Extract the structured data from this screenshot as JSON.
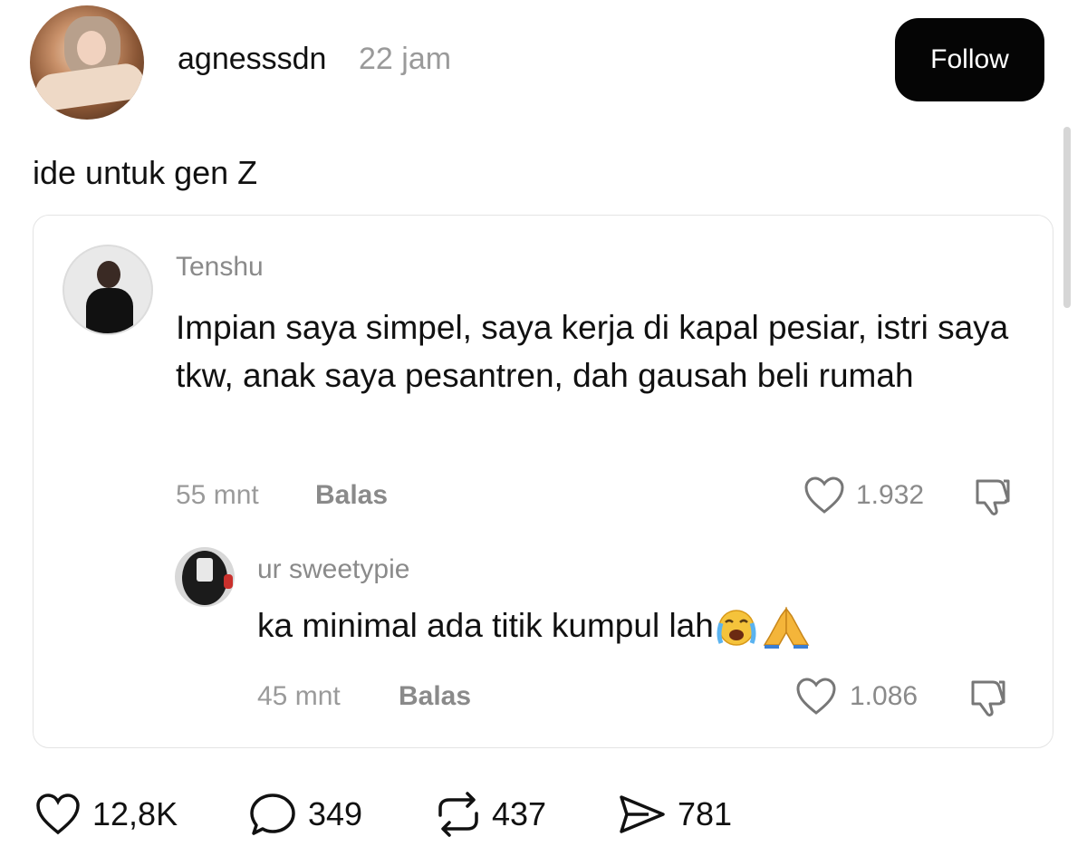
{
  "post": {
    "username": "agnesssdn",
    "time": "22 jam",
    "follow_label": "Follow",
    "caption": "ide untuk gen Z"
  },
  "quoted_thread": {
    "comment": {
      "author": "Tenshu",
      "text": "Impian saya simpel, saya kerja di kapal pesiar, istri saya tkw, anak saya pesantren, dah gausah beli rumah",
      "time": "55 mnt",
      "reply_label": "Balas",
      "likes": "1.932"
    },
    "reply": {
      "author": "ur sweetypie",
      "text": "ka minimal ada titik kumpul lah",
      "emojis": [
        "crying-face",
        "folded-hands"
      ],
      "time": "45 mnt",
      "reply_label": "Balas",
      "likes": "1.086"
    }
  },
  "stats": {
    "likes": "12,8K",
    "comments": "349",
    "reposts": "437",
    "shares": "781"
  }
}
